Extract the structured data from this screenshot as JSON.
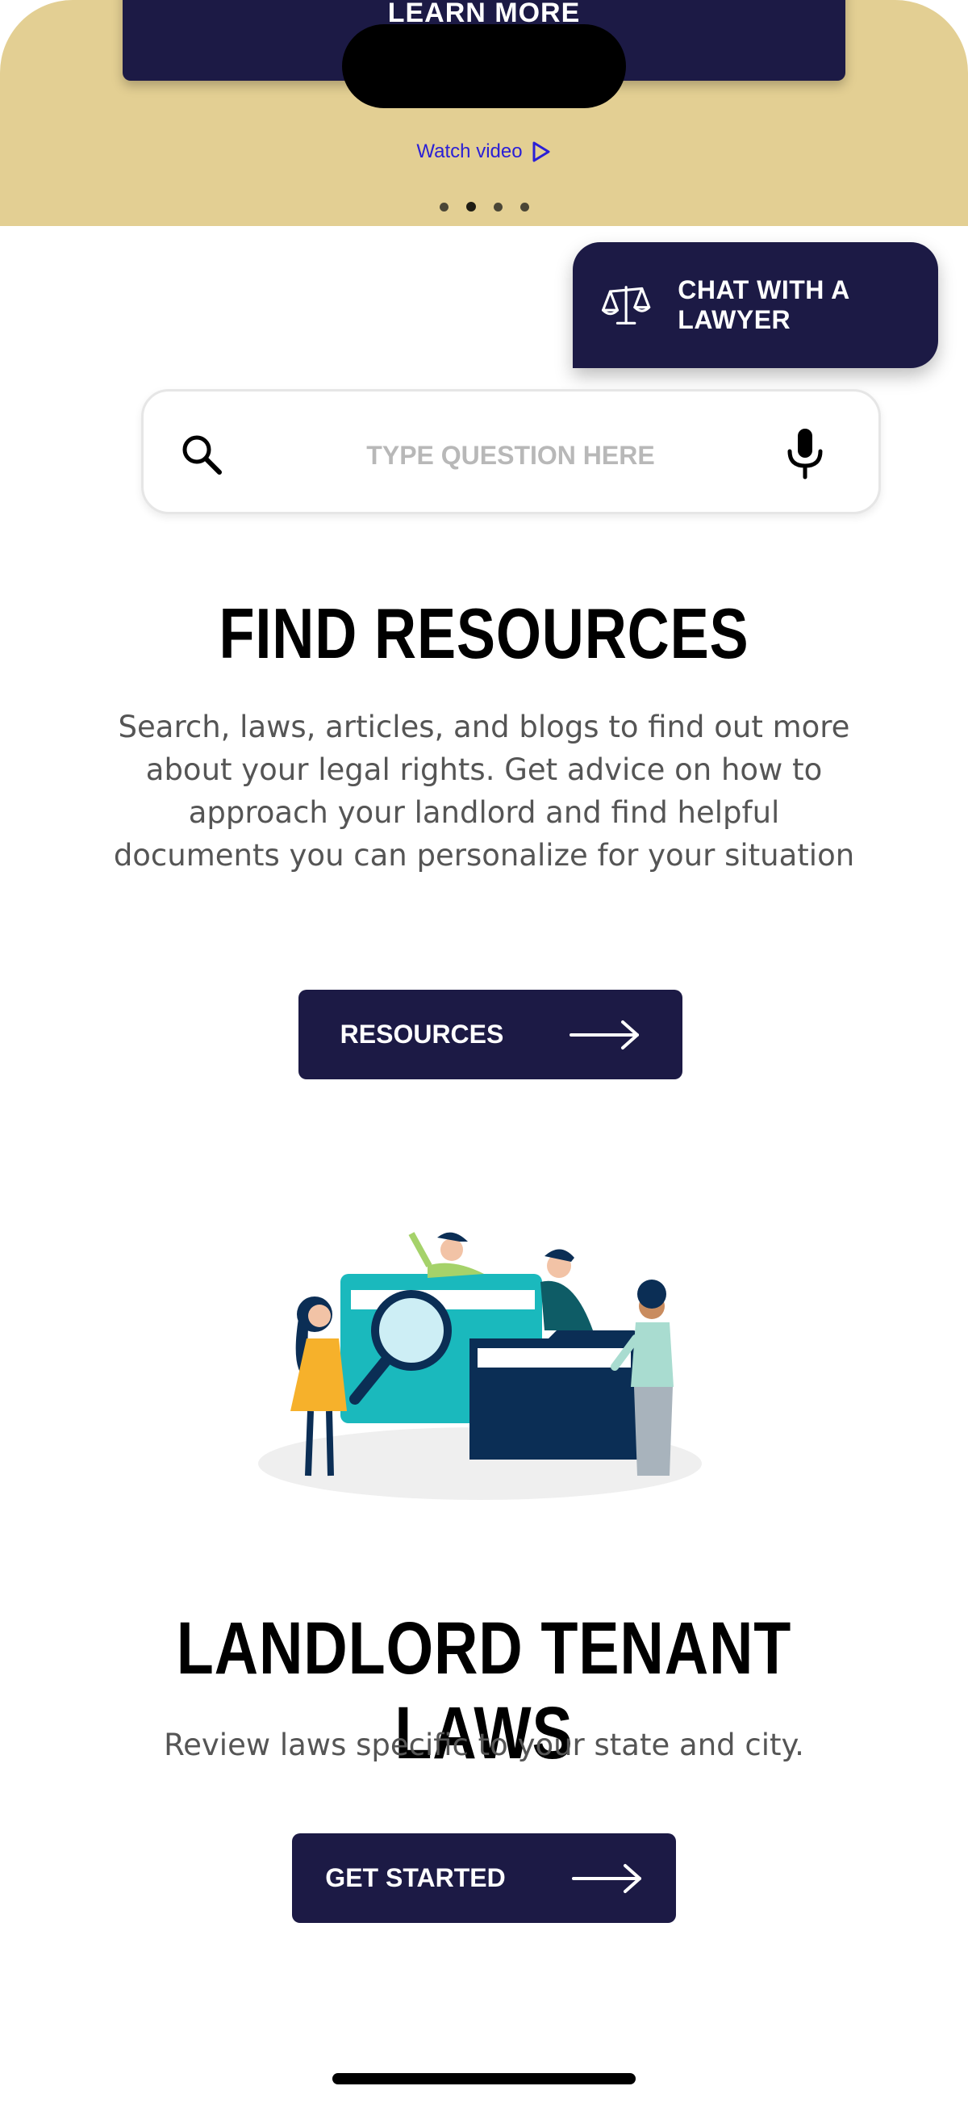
{
  "hero": {
    "learn_more_label": "LEARN MORE",
    "watch_video_label": "Watch video",
    "carousel": {
      "total": 4,
      "active_index": 2
    },
    "background_color": "#e3cf93"
  },
  "chat": {
    "label": "CHAT WITH A LAWYER",
    "icon": "scales-icon"
  },
  "search": {
    "placeholder": "TYPE QUESTION HERE",
    "value": "",
    "search_icon": "search-icon",
    "mic_icon": "microphone-icon"
  },
  "find_resources": {
    "title": "FIND RESOURCES",
    "body": "Search, laws, articles, and blogs to find out more about your legal rights. Get advice on how to approach your landlord and find helpful documents you can personalize for your situation",
    "button_label": "RESOURCES",
    "button_icon": "arrow-right-icon",
    "illustration": "people-searching-folders-illustration"
  },
  "landlord_laws": {
    "title": "LANDLORD TENANT LAWS",
    "body": "Review laws specific to your state and city.",
    "button_label": "GET STARTED",
    "button_icon": "arrow-right-icon"
  },
  "colors": {
    "primary": "#1c1a45",
    "link": "#2a1fd6",
    "body_text": "#555555"
  }
}
